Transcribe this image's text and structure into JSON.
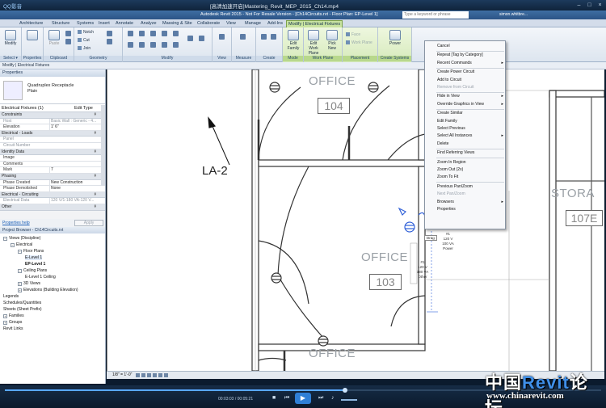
{
  "player": {
    "logo": "QQ影音",
    "title": "[高清加速开启]Mastering_Revit_MEP_2015_Ch14.mp4",
    "time": "00:03:03 / 00:05:21",
    "progress_fraction": 0.57
  },
  "revit": {
    "title": "Autodesk Revit 2015 - Not For Resale Version - [Ch14Circuits.rvt - Floor Plan: EP-Level 1]",
    "search_placeholder": "Type a keyword or phrase",
    "user": "simon.whitbre..."
  },
  "ribbon_tabs": [
    "Architecture",
    "Structure",
    "Systems",
    "Insert",
    "Annotate",
    "Analyze",
    "Massing & Site",
    "Collaborate",
    "View",
    "Manage",
    "Add-Ins",
    "Modify | Electrical Fixtures"
  ],
  "ribbon": {
    "modify": "Modify",
    "select": "Select ▾",
    "properties": "Properties",
    "clipboard": "Clipboard",
    "paste": "Paste",
    "notch": "Notch",
    "cut": "Cut",
    "join": "Join",
    "geometry": "Geometry",
    "modify_group": "Modify",
    "view": "View",
    "measure": "Measure",
    "create": "Create",
    "edit_family": "Edit Family",
    "mode": "Mode",
    "edit_work_plane": "Edit Work Plane",
    "pick_new": "Pick New",
    "work_plane": "Work Plane",
    "face": "Face",
    "work_plane_small": "Work Plane",
    "placement": "Placement",
    "power": "Power",
    "create_systems": "Create Systems"
  },
  "context_strip": "Modify | Electrical Fixtures",
  "properties": {
    "header": "Properties",
    "type_name": "Quadruplex Receptacle",
    "type_sub": "Plain",
    "selector": "Electrical Fixtures (1)",
    "edit_type": "Edit Type",
    "sections": [
      {
        "name": "Constraints",
        "rows": [
          [
            "Host",
            "Basic Wall : Generic - 4...",
            true
          ],
          [
            "Elevation",
            "1' 6\"",
            false
          ]
        ]
      },
      {
        "name": "Electrical - Loads",
        "rows": [
          [
            "Panel",
            "",
            true
          ],
          [
            "Circuit Number",
            "",
            true
          ]
        ]
      },
      {
        "name": "Identity Data",
        "rows": [
          [
            "Image",
            "",
            false
          ],
          [
            "Comments",
            "",
            false
          ],
          [
            "Mark",
            "7",
            false
          ]
        ]
      },
      {
        "name": "Phasing",
        "rows": [
          [
            "Phase Created",
            "New Construction",
            false
          ],
          [
            "Phase Demolished",
            "None",
            false
          ]
        ]
      },
      {
        "name": "Electrical - Circuiting",
        "rows": [
          [
            "Electrical Data",
            "120 V/1-180 VA-120 V...",
            true
          ]
        ]
      },
      {
        "name": "Other",
        "rows": []
      }
    ],
    "help_link": "Properties help",
    "apply": "Apply"
  },
  "browser": {
    "header": "Project Browser - Ch14Circuits.rvt",
    "items": [
      {
        "label": "Views (Discipline)",
        "level": 0,
        "toggle": "−",
        "bold": false,
        "sel": false
      },
      {
        "label": "Electrical",
        "level": 1,
        "toggle": "−",
        "bold": false,
        "sel": false
      },
      {
        "label": "Floor Plans",
        "level": 2,
        "toggle": "−",
        "bold": false,
        "sel": false
      },
      {
        "label": "E-Level 1",
        "level": 3,
        "toggle": "",
        "bold": false,
        "sel": true
      },
      {
        "label": "EP-Level 1",
        "level": 3,
        "toggle": "",
        "bold": true,
        "sel": false
      },
      {
        "label": "Ceiling Plans",
        "level": 2,
        "toggle": "−",
        "bold": false,
        "sel": false
      },
      {
        "label": "E-Level 1 Ceiling",
        "level": 3,
        "toggle": "",
        "bold": false,
        "sel": false
      },
      {
        "label": "3D Views",
        "level": 2,
        "toggle": "+",
        "bold": false,
        "sel": false
      },
      {
        "label": "Elevations (Building Elevation)",
        "level": 2,
        "toggle": "+",
        "bold": false,
        "sel": false
      },
      {
        "label": "Legends",
        "level": 0,
        "toggle": "",
        "bold": false,
        "sel": false
      },
      {
        "label": "Schedules/Quantities",
        "level": 0,
        "toggle": "",
        "bold": false,
        "sel": false
      },
      {
        "label": "Sheets (Sheet Prefix)",
        "level": 0,
        "toggle": "",
        "bold": false,
        "sel": false
      },
      {
        "label": "Families",
        "level": 0,
        "toggle": "+",
        "bold": false,
        "sel": false
      },
      {
        "label": "Groups",
        "level": 0,
        "toggle": "+",
        "bold": false,
        "sel": false
      },
      {
        "label": "Revit Links",
        "level": 0,
        "toggle": "",
        "bold": false,
        "sel": false
      }
    ]
  },
  "canvas": {
    "rooms": [
      {
        "name": "OFFICE",
        "number": "104"
      },
      {
        "name": "OFFICE",
        "number": "103"
      },
      {
        "name": "OFFICE",
        "number": ""
      },
      {
        "name": "STORA",
        "number": "107E"
      }
    ],
    "tag": "LA-2",
    "drag_tip": "Drag",
    "fixture_note_top": "#1\n120 V\n100 VA\nPower",
    "fixture_note_bottom": "#1\n120 V\n180 VA\nOther"
  },
  "context_menu": {
    "items": [
      {
        "label": "Cancel",
        "disabled": false,
        "sub": false,
        "sep_after": true
      },
      {
        "label": "Repeat [Tag by Category]",
        "disabled": false,
        "sub": false,
        "sep_after": false
      },
      {
        "label": "Recent Commands",
        "disabled": false,
        "sub": true,
        "sep_after": true
      },
      {
        "label": "Create Power Circuit",
        "disabled": false,
        "sub": false,
        "sep_after": false
      },
      {
        "label": "Add to Circuit",
        "disabled": false,
        "sub": false,
        "sep_after": false
      },
      {
        "label": "Remove from Circuit",
        "disabled": true,
        "sub": false,
        "sep_after": true
      },
      {
        "label": "Hide in View",
        "disabled": false,
        "sub": true,
        "sep_after": false
      },
      {
        "label": "Override Graphics in View",
        "disabled": false,
        "sub": true,
        "sep_after": true
      },
      {
        "label": "Create Similar",
        "disabled": false,
        "sub": false,
        "sep_after": false
      },
      {
        "label": "Edit Family",
        "disabled": false,
        "sub": false,
        "sep_after": false
      },
      {
        "label": "Select Previous",
        "disabled": false,
        "sub": false,
        "sep_after": false
      },
      {
        "label": "Select All Instances",
        "disabled": false,
        "sub": true,
        "sep_after": false
      },
      {
        "label": "Delete",
        "disabled": false,
        "sub": false,
        "sep_after": true
      },
      {
        "label": "Find Referring Views",
        "disabled": false,
        "sub": false,
        "sep_after": true
      },
      {
        "label": "Zoom In Region",
        "disabled": false,
        "sub": false,
        "sep_after": false
      },
      {
        "label": "Zoom Out (2x)",
        "disabled": false,
        "sub": false,
        "sep_after": false
      },
      {
        "label": "Zoom To Fit",
        "disabled": false,
        "sub": false,
        "sep_after": true
      },
      {
        "label": "Previous Pan/Zoom",
        "disabled": false,
        "sub": false,
        "sep_after": false
      },
      {
        "label": "Next Pan/Zoom",
        "disabled": true,
        "sub": false,
        "sep_after": false
      },
      {
        "label": "Browsers",
        "disabled": false,
        "sub": true,
        "sep_after": false
      },
      {
        "label": "Properties",
        "disabled": false,
        "sub": false,
        "sep_after": false
      }
    ]
  },
  "viewbar": {
    "scale": "1/8\" = 1'-0\""
  },
  "watermark": {
    "line1_a": "中国",
    "line1_b": "Revit",
    "line1_c": "论坛",
    "line2": "www.chinarevit.com"
  }
}
